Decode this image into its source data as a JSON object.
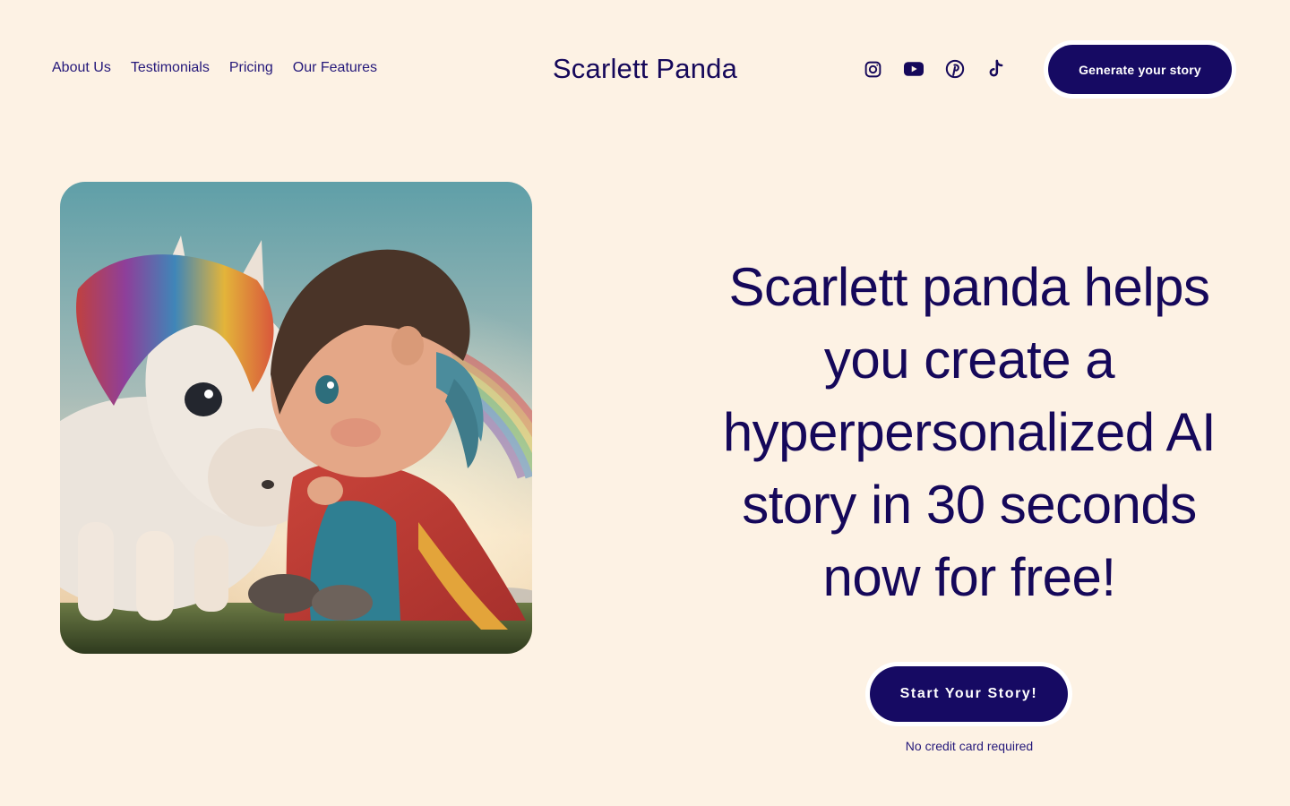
{
  "header": {
    "nav": [
      {
        "label": "About Us"
      },
      {
        "label": "Testimonials"
      },
      {
        "label": "Pricing"
      },
      {
        "label": "Our Features"
      }
    ],
    "brand": "Scarlett Panda",
    "social_icons": [
      "instagram-icon",
      "youtube-icon",
      "pinterest-icon",
      "tiktok-icon"
    ],
    "cta_label": "Generate your story"
  },
  "hero": {
    "image_alt": "",
    "headline": "Scarlett panda helps you create a hyperpersonalized AI story in 30 seconds now for free!",
    "cta_label": "Start Your Story!",
    "note": "No credit card required"
  },
  "colors": {
    "background": "#fdf2e4",
    "primary": "#160a63",
    "text": "#15085a"
  }
}
